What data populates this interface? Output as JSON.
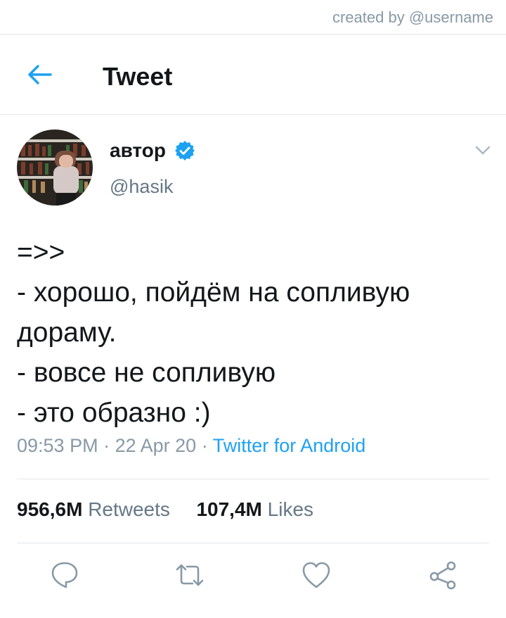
{
  "credit": "created by @username",
  "header": {
    "title": "Tweet",
    "back_icon": "arrow-left-icon"
  },
  "author": {
    "name": "автор",
    "handle": "@hasik",
    "verified": true
  },
  "tweet": {
    "lines": [
      "=>>",
      "- хорошо, пойдём на сопливую",
      "дораму.",
      "- вовсе не сопливую",
      "- это образно :)"
    ]
  },
  "meta": {
    "time": "09:53 PM",
    "date": "22 Apr 20",
    "source": "Twitter for Android"
  },
  "stats": {
    "retweets_count": "956,6M",
    "retweets_label": "Retweets",
    "likes_count": "107,4M",
    "likes_label": "Likes"
  },
  "actions": [
    "reply-icon",
    "retweet-icon",
    "like-icon",
    "share-icon"
  ],
  "colors": {
    "accent": "#1da1f2",
    "muted": "#8899a6",
    "divider": "#e1e8ed"
  }
}
